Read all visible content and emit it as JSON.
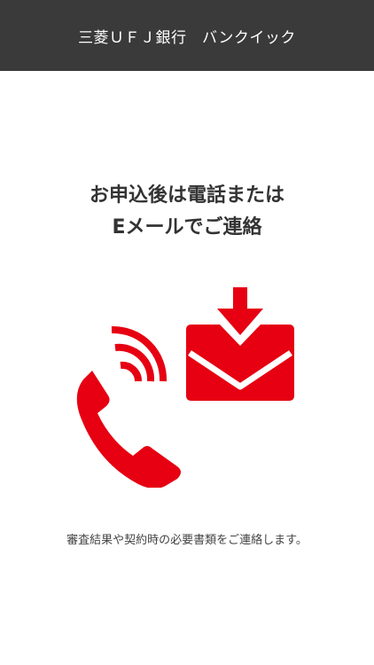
{
  "header": {
    "title": "三菱ＵＦＪ銀行　バンクイック"
  },
  "headline": {
    "line1": "お申込後は電話または",
    "line2": "Eメールでご連絡"
  },
  "caption": "審査結果や契約時の必要書類をご連絡します。",
  "icons": {
    "phone": "phone-ringing-icon",
    "mail": "mail-download-icon"
  },
  "colors": {
    "header_bg": "#3a3a3a",
    "accent": "#e60012",
    "text": "#333333"
  }
}
